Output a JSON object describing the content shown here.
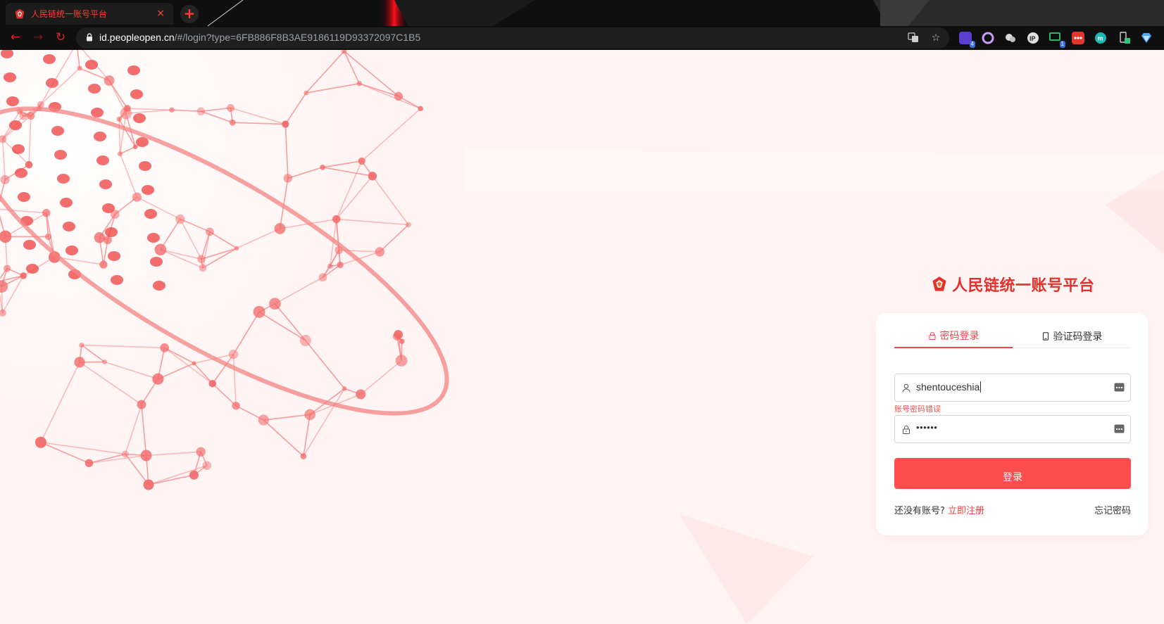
{
  "browser": {
    "tab_title": "人民链统一账号平台",
    "tab_close": "×",
    "new_tab": "+",
    "url_host": "id.peopleopen.cn",
    "url_path": "/#/login?type=6FB886F8B3AE9186119D93372097C1B5",
    "extension_badge": "4",
    "extension_count_badge": "1",
    "accent_color": "#e0261c",
    "icons": [
      "back-arrow-icon",
      "forward-arrow-icon",
      "reload-icon",
      "lock-icon",
      "translate-icon",
      "star-icon"
    ]
  },
  "brand": {
    "title": "人民链统一账号平台",
    "color": "#e3322b"
  },
  "login": {
    "tabs": [
      {
        "label": "密码登录",
        "icon": "lock-icon",
        "active": true
      },
      {
        "label": "验证码登录",
        "icon": "phone-icon",
        "active": false
      }
    ],
    "username": "shentouceshia",
    "error_message": "账号密码错误",
    "password_masked": "••••••",
    "submit_label": "登录",
    "no_account_text": "还没有账号?",
    "register_link": "立即注册",
    "forgot_password": "忘记密码",
    "button_color": "#ff4c4c"
  }
}
